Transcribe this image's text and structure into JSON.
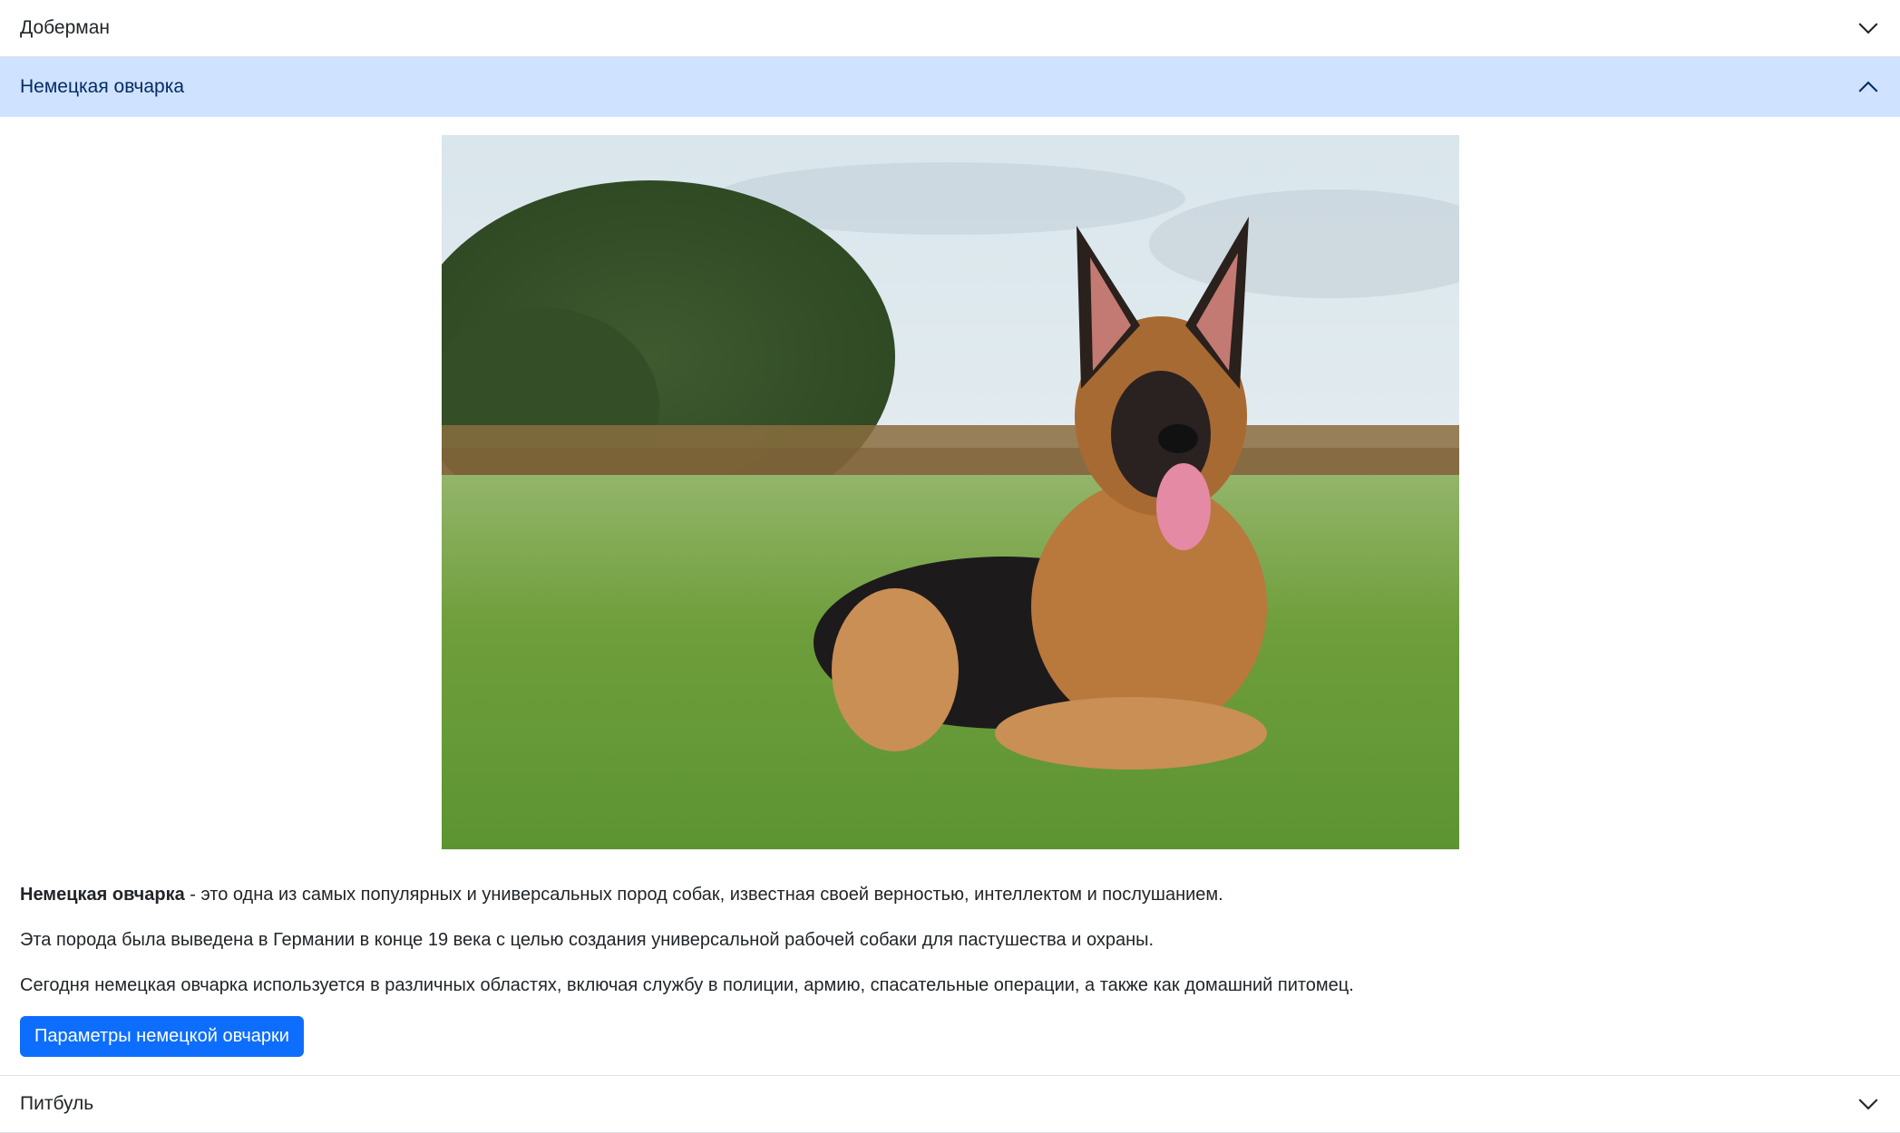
{
  "accordion": {
    "items": [
      {
        "label": "Доберман",
        "expanded": false,
        "icon": "chevron-down-icon"
      },
      {
        "label": "Немецкая овчарка",
        "expanded": true,
        "icon": "chevron-up-icon"
      },
      {
        "label": "Питбуль",
        "expanded": false,
        "icon": "chevron-down-icon"
      }
    ]
  },
  "shepherd": {
    "intro_bold": "Немецкая овчарка",
    "intro_rest": " - это одна из самых популярных и универсальных пород собак, известная своей верностью, интеллектом и послушанием.",
    "history": "Эта порода была выведена в Германии в конце 19 века с целью создания универсальной рабочей собаки для пастушества и охраны.",
    "today": "Сегодня немецкая овчарка используется в различных областях, включая службу в полиции, армию, спасательные операции, а также как домашний питомец.",
    "button_label": "Параметры немецкой овчарки"
  },
  "colors": {
    "active_header_bg": "#cfe2ff",
    "button_bg": "#0d6efd"
  }
}
